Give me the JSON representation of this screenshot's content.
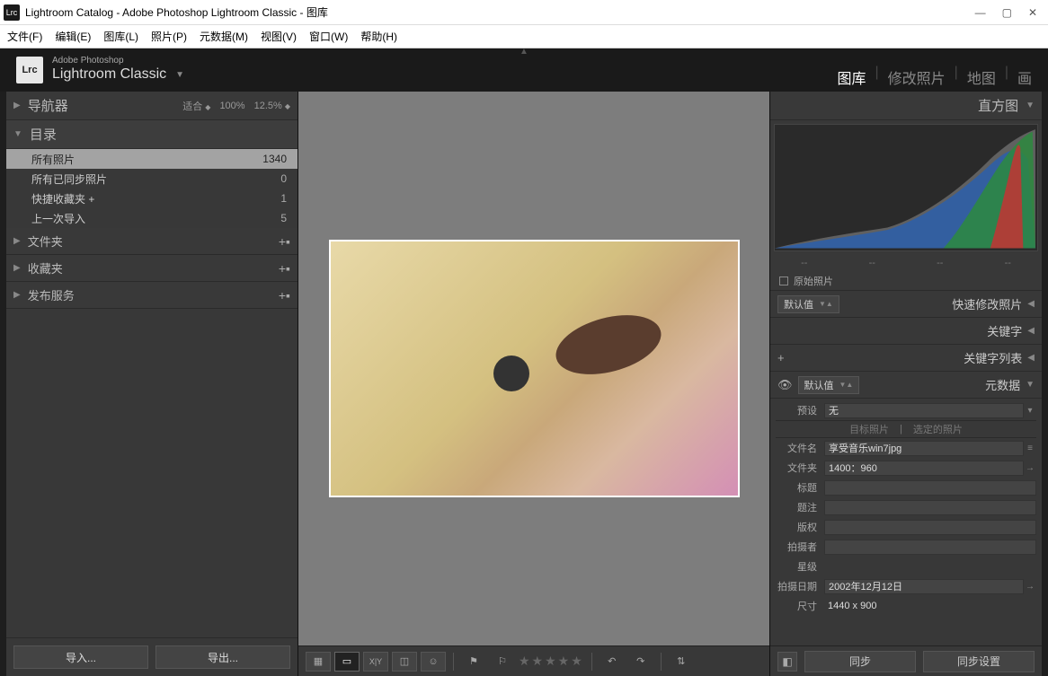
{
  "window": {
    "title": "Lightroom Catalog - Adobe Photoshop Lightroom Classic - 图库",
    "app_icon": "Lrc"
  },
  "menubar": [
    "文件(F)",
    "编辑(E)",
    "图库(L)",
    "照片(P)",
    "元数据(M)",
    "视图(V)",
    "窗口(W)",
    "帮助(H)"
  ],
  "identity": {
    "small": "Adobe Photoshop",
    "large": "Lightroom Classic",
    "logo": "Lrc"
  },
  "modules": [
    "图库",
    "修改照片",
    "地图",
    "画"
  ],
  "nav": {
    "title": "导航器",
    "fit": "适合",
    "zoom1": "100%",
    "zoom2": "12.5%"
  },
  "catalog": {
    "title": "目录",
    "items": [
      {
        "label": "所有照片",
        "count": "1340"
      },
      {
        "label": "所有已同步照片",
        "count": "0"
      },
      {
        "label": "快捷收藏夹 +",
        "count": "1"
      },
      {
        "label": "上一次导入",
        "count": "5"
      }
    ]
  },
  "left_sections": [
    {
      "title": "文件夹"
    },
    {
      "title": "收藏夹"
    },
    {
      "title": "发布服务"
    }
  ],
  "left_buttons": {
    "import": "导入...",
    "export": "导出..."
  },
  "right": {
    "histogram": "直方图",
    "original": "原始照片",
    "quick": {
      "preset": "默认值",
      "title": "快速修改照片"
    },
    "keywords": "关键字",
    "keyword_list": "关键字列表",
    "metadata": {
      "view": "默认值",
      "title": "元数据"
    },
    "preset": {
      "label": "预设",
      "value": "无"
    },
    "meta_tabs": [
      "目标照片",
      "选定的照片"
    ],
    "fields": [
      {
        "label": "文件名",
        "value": "享受音乐win7jpg",
        "icon": "≡"
      },
      {
        "label": "文件夹",
        "value": "1400：960",
        "icon": "→"
      },
      {
        "label": "标题",
        "value": ""
      },
      {
        "label": "题注",
        "value": ""
      },
      {
        "label": "版权",
        "value": ""
      },
      {
        "label": "拍摄者",
        "value": ""
      },
      {
        "label": "星级",
        "value": "",
        "plain": true
      },
      {
        "label": "拍摄日期",
        "value": "2002年12月12日",
        "icon": "→"
      },
      {
        "label": "尺寸",
        "value": "1440 x 900",
        "plain": true
      }
    ],
    "sync": "同步",
    "sync_settings": "同步设置"
  },
  "hist_dashes": [
    "--",
    "--",
    "--",
    "--"
  ]
}
